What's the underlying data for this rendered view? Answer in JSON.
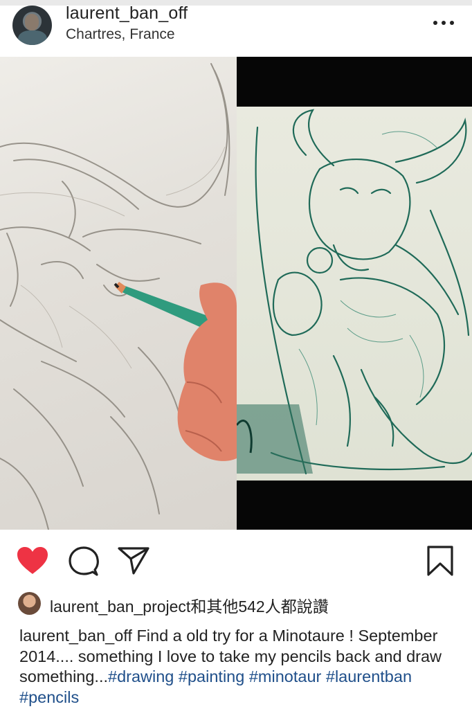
{
  "post": {
    "username": "laurent_ban_off",
    "location": "Chartres, France"
  },
  "icons": {
    "more": "more-options-icon",
    "like": "heart-icon",
    "comment": "comment-icon",
    "share": "share-icon",
    "save": "bookmark-icon"
  },
  "colors": {
    "like": "#ee3344",
    "hashtag": "#1f4f8a",
    "text": "#222222"
  },
  "likes": {
    "text": "laurent_ban_project和其他542人都說讚"
  },
  "caption": {
    "username": "laurent_ban_off",
    "text": "Find a old try for a Minotaure ! September 2014.... something I love to take my pencils back and draw something...",
    "hashtags": [
      "#drawing",
      "#painting",
      "#minotaur",
      "#laurentban",
      "#pencils"
    ]
  }
}
